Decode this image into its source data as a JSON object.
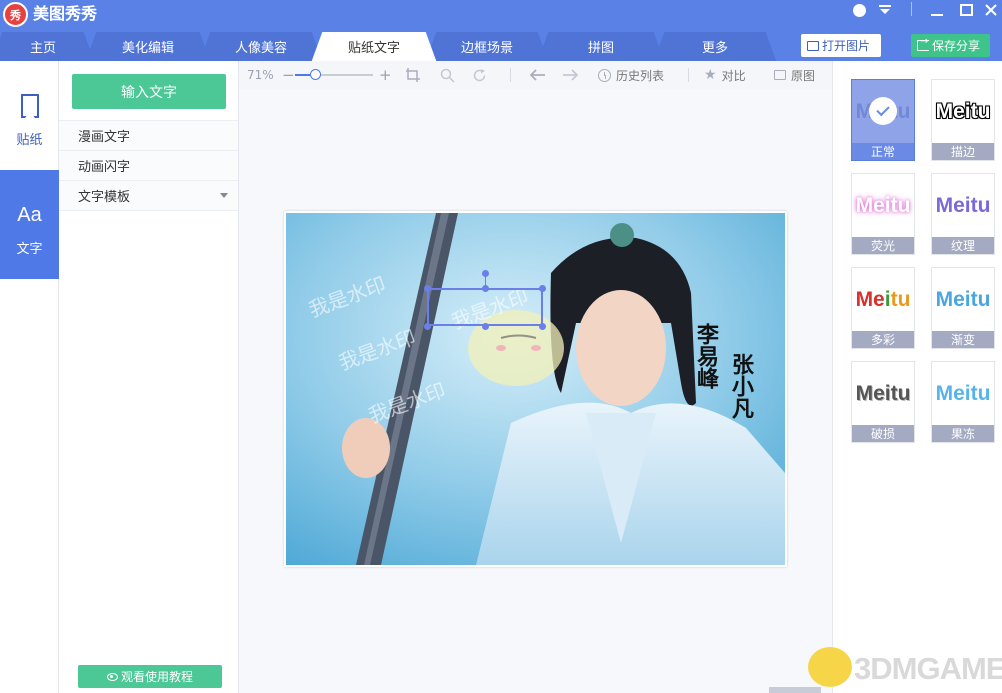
{
  "app": {
    "title": "美图秀秀",
    "logo_text": "秀"
  },
  "tabs": [
    {
      "label": "主页"
    },
    {
      "label": "美化编辑"
    },
    {
      "label": "人像美容"
    },
    {
      "label": "贴纸文字",
      "active": true
    },
    {
      "label": "边框场景"
    },
    {
      "label": "拼图"
    },
    {
      "label": "更多"
    }
  ],
  "header_actions": {
    "open": "打开图片",
    "save": "保存分享"
  },
  "rail": [
    {
      "label": "贴纸",
      "icon": "bookmark-icon"
    },
    {
      "label": "文字",
      "icon": "text-aa-icon",
      "active": true
    }
  ],
  "panel": {
    "input_button": "输入文字",
    "items": [
      {
        "label": "漫画文字"
      },
      {
        "label": "动画闪字"
      },
      {
        "label": "文字模板"
      }
    ],
    "tutorial_button": "观看使用教程"
  },
  "toolbar": {
    "zoom": "71%",
    "zoom_fraction": 0.19,
    "history": "历史列表",
    "compare": "对比",
    "original": "原图"
  },
  "photo": {
    "watermark": "我是水印",
    "calligraphy_left": "李易峰",
    "calligraphy_right": "张小凡"
  },
  "effects": [
    {
      "label": "正常",
      "preview": "Meitu",
      "active": true
    },
    {
      "label": "描边",
      "preview": "Meitu"
    },
    {
      "label": "荧光",
      "preview": "Meitu"
    },
    {
      "label": "纹理",
      "preview": "Meitu"
    },
    {
      "label": "多彩",
      "preview": "Meitu"
    },
    {
      "label": "渐变",
      "preview": "Meitu"
    },
    {
      "label": "破损",
      "preview": "Meitu"
    },
    {
      "label": "果冻",
      "preview": "Meitu"
    }
  ],
  "brand_watermark": "3DMGAME",
  "colors": {
    "primary": "#5a82e6",
    "green": "#4cc796",
    "selection": "#6b7fe8"
  }
}
